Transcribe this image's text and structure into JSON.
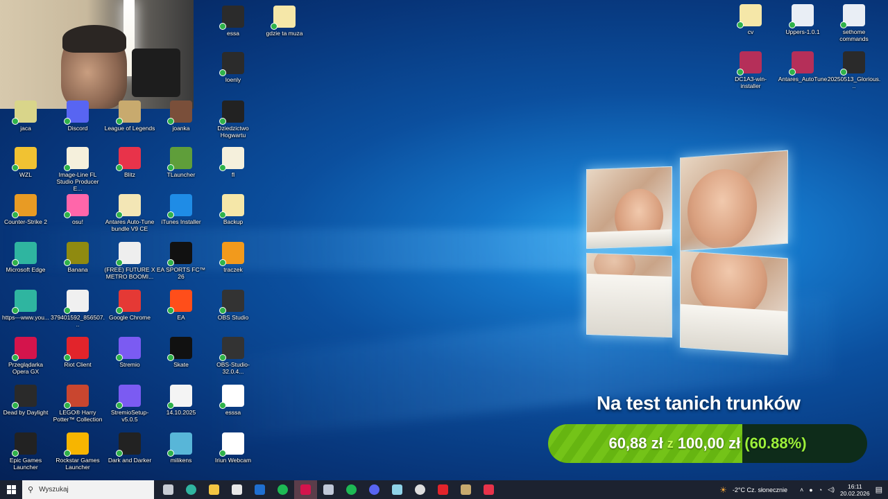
{
  "webcam": {
    "label": "webcam overlay"
  },
  "icons_left": [
    {
      "label": "jaca",
      "color": "#d9d58a"
    },
    {
      "label": "Discord",
      "color": "#5865f2"
    },
    {
      "label": "League of Legends",
      "color": "#c8aa6e"
    },
    {
      "label": "joanka",
      "color": "#7a4f3a"
    },
    {
      "label": "WZL",
      "color": "#f1c232"
    },
    {
      "label": "Image-Line FL Studio Producer E...",
      "color": "#f5f0dc"
    },
    {
      "label": "Blitz",
      "color": "#e8334a"
    },
    {
      "label": "TLauncher",
      "color": "#5f9e3a"
    },
    {
      "label": "Counter-Strike 2",
      "color": "#e89b24"
    },
    {
      "label": "osu!",
      "color": "#ff66aa"
    },
    {
      "label": "Antares Auto-Tune bundle V9 CE",
      "color": "#f3e6b5"
    },
    {
      "label": "iTunes Installer",
      "color": "#1f8ce6"
    },
    {
      "label": "Microsoft Edge",
      "color": "#2fb5a0"
    },
    {
      "label": "Banana",
      "color": "#8f8a10"
    },
    {
      "label": "(FREE) FUTURE X METRO BOOMI...",
      "color": "#eeeeee"
    },
    {
      "label": "EA SPORTS FC™ 26",
      "color": "#111111"
    },
    {
      "label": "https---www.you...",
      "color": "#2fb5a0"
    },
    {
      "label": "379401592_856507...",
      "color": "#f0f0f0"
    },
    {
      "label": "Google Chrome",
      "color": "#e53935"
    },
    {
      "label": "EA",
      "color": "#ff4e1a"
    },
    {
      "label": "Przeglądarka Opera GX",
      "color": "#d4144c"
    },
    {
      "label": "Riot Client",
      "color": "#e2242b"
    },
    {
      "label": "Stremio",
      "color": "#7b5bf2"
    },
    {
      "label": "Skate",
      "color": "#111111"
    },
    {
      "label": "Dead by Daylight",
      "color": "#2a2a2a"
    },
    {
      "label": "LEGO® Harry Potter™ Collection",
      "color": "#c9462f"
    },
    {
      "label": "StremioSetup-v5.0.5",
      "color": "#7b5bf2"
    },
    {
      "label": "14.10.2025",
      "color": "#f4f4f4"
    },
    {
      "label": "Epic Games Launcher",
      "color": "#222222"
    },
    {
      "label": "Rockstar Games Launcher",
      "color": "#f7b500"
    },
    {
      "label": "Dark and Darker",
      "color": "#222222"
    },
    {
      "label": "milikens",
      "color": "#58b6d8"
    }
  ],
  "icons_col5": [
    {
      "label": "essa",
      "color": "#2b2b2b"
    },
    {
      "label": "loenly",
      "color": "#2b2b2b"
    },
    {
      "label": "Dziedzictwo Hogwartu",
      "color": "#222222"
    },
    {
      "label": "fl",
      "color": "#f5f0dc"
    },
    {
      "label": "Backup",
      "color": "#f5e7a8"
    },
    {
      "label": "traczek",
      "color": "#f29a1c"
    },
    {
      "label": "OBS Studio",
      "color": "#333333"
    },
    {
      "label": "OBS-Studio-32.0.4...",
      "color": "#333333"
    },
    {
      "label": "esssa",
      "color": "#ffffff"
    },
    {
      "label": "Iriun Webcam",
      "color": "#ffffff"
    }
  ],
  "icon_gdzie": {
    "label": "gdzie ta muza",
    "color": "#f5e7a8"
  },
  "icons_right": [
    {
      "label": "cv",
      "color": "#f5e7a8"
    },
    {
      "label": "Uppers-1.0.1",
      "color": "#e9eef5"
    },
    {
      "label": "sethome commands",
      "color": "#e9eef5"
    },
    {
      "label": "DC1A3-win-installer",
      "color": "#b52f59"
    },
    {
      "label": "Antares_AutoTune",
      "color": "#b52f59"
    },
    {
      "label": "20250513_Glorious...",
      "color": "#2a2a2a"
    }
  ],
  "promo": {
    "title": "Na test tanich trunków",
    "current": "60,88 zł",
    "separator": "z",
    "goal": "100,00 zł",
    "percent_text": "(60.88%)",
    "progress": 0.6088
  },
  "taskbar": {
    "search_placeholder": "Wyszukaj",
    "apps": [
      {
        "name": "task-view",
        "color": "#c8ccd4"
      },
      {
        "name": "edge",
        "color": "#2fb5a0"
      },
      {
        "name": "file-explorer",
        "color": "#f4c542"
      },
      {
        "name": "store",
        "color": "#e8e8e8"
      },
      {
        "name": "outlook",
        "color": "#1f6fd0"
      },
      {
        "name": "spotify",
        "color": "#1db954"
      },
      {
        "name": "opera-gx",
        "color": "#d4144c"
      },
      {
        "name": "files",
        "color": "#c0c8d8"
      },
      {
        "name": "spotify-2",
        "color": "#1db954"
      },
      {
        "name": "discord",
        "color": "#5865f2"
      },
      {
        "name": "notes",
        "color": "#8fd3e8"
      },
      {
        "name": "obs",
        "color": "#dddddd"
      },
      {
        "name": "riot",
        "color": "#e2242b"
      },
      {
        "name": "league",
        "color": "#c8aa6e"
      },
      {
        "name": "blitz",
        "color": "#e8334a"
      }
    ],
    "weather": "-2°C  Cz. słonecznie",
    "time": "16:11",
    "date": "20.02.2026"
  }
}
